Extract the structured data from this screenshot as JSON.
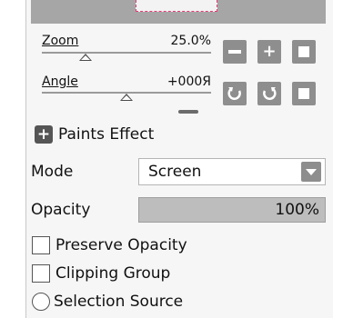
{
  "navigator": {
    "zoom": {
      "label": "Zoom",
      "value": "25.0%",
      "position": 0.26
    },
    "angle": {
      "label": "Angle",
      "value": "+000Я",
      "position": 0.5
    },
    "buttons": {
      "zoom_out": "minus-icon",
      "zoom_in": "plus-icon",
      "zoom_reset": "square-icon",
      "rotate_left": "rotate-left-icon",
      "rotate_right": "rotate-right-icon",
      "angle_reset": "square-icon"
    }
  },
  "effect": {
    "toggle_glyph": "+",
    "title": "Paints Effect"
  },
  "mode": {
    "label": "Mode",
    "value": "Screen"
  },
  "opacity": {
    "label": "Opacity",
    "value": "100%",
    "fraction": 1.0
  },
  "options": {
    "preserve_opacity": {
      "label": "Preserve Opacity",
      "checked": false
    },
    "clipping_group": {
      "label": "Clipping Group",
      "checked": false
    },
    "selection_source": {
      "label": "Selection Source",
      "checked": false
    }
  },
  "colors": {
    "panel": "#f6f6f6",
    "button": "#8e8e8e",
    "viewport_border": "#e53a78"
  }
}
